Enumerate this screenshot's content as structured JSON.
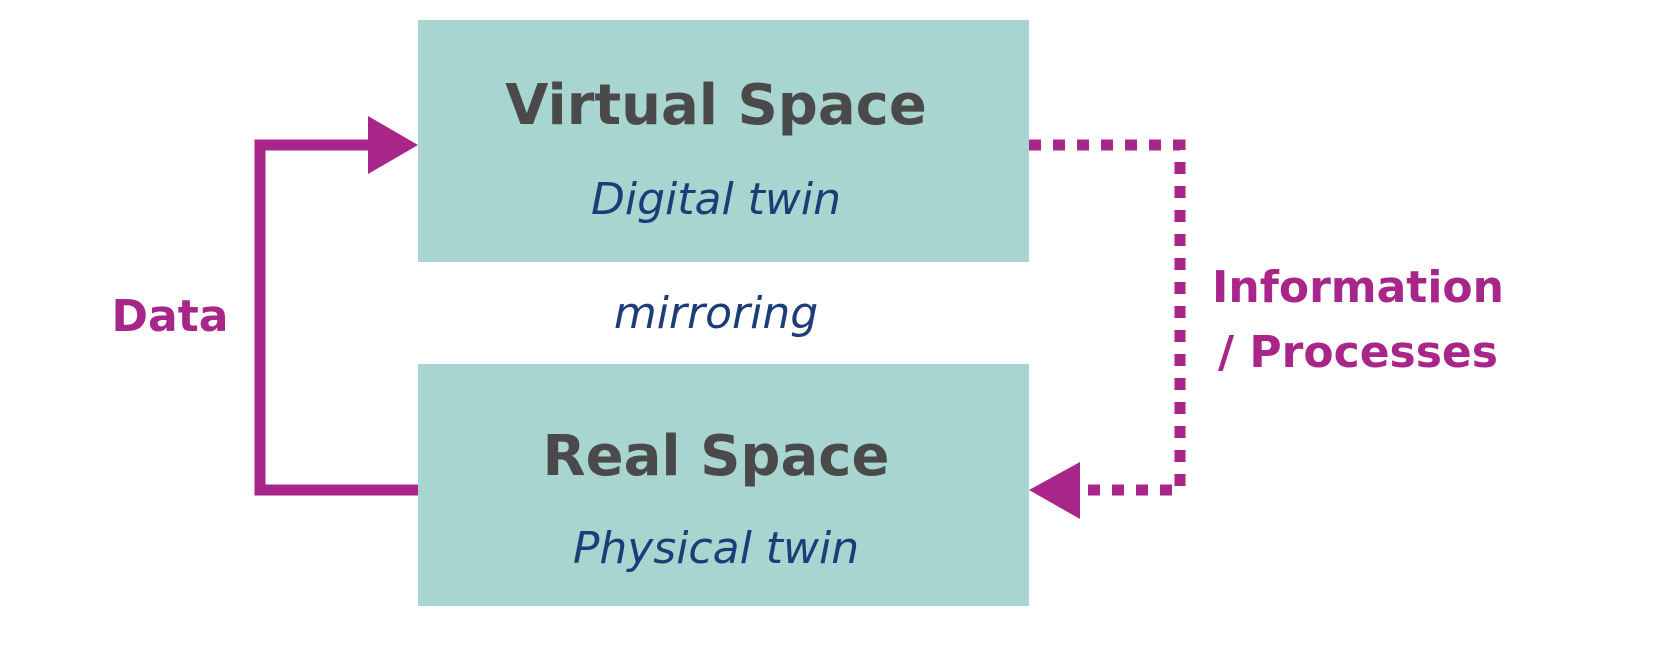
{
  "colors": {
    "box_fill": "#a8d5cf",
    "accent": "#a8258a",
    "title_text": "#4a4a4a",
    "subtitle_text": "#1c3d78"
  },
  "virtual_box": {
    "title": "Virtual Space",
    "subtitle": "Digital twin"
  },
  "real_box": {
    "title": "Real Space",
    "subtitle": "Physical twin"
  },
  "center_label": "mirroring",
  "left_arrow": {
    "label": "Data",
    "style": "solid"
  },
  "right_arrow": {
    "label_line1": "Information",
    "label_line2": "/ Processes",
    "style": "dotted"
  }
}
